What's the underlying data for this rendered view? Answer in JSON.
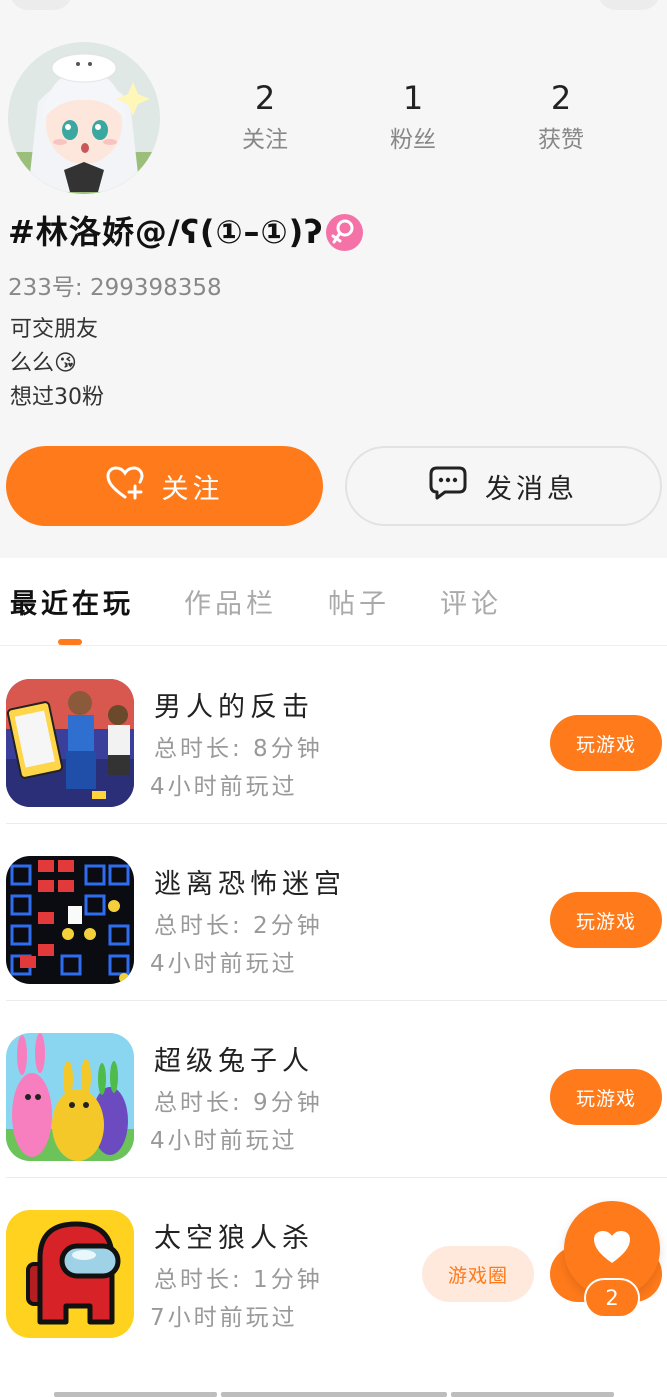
{
  "profile": {
    "nickname": "#林洛娇@/ʕ(①–①)ʔ",
    "uid_text": "233号: 299398358",
    "bio_lines": [
      "可交朋友",
      "么么😘",
      "想过30粉"
    ],
    "stats": [
      {
        "value": "2",
        "label": "关注"
      },
      {
        "value": "1",
        "label": "粉丝"
      },
      {
        "value": "2",
        "label": "获赞"
      }
    ],
    "gender_symbol": "♀",
    "follow_label": "关注",
    "message_label": "发消息",
    "accent_color": "#ff7a1a",
    "gender_color": "#f472a8"
  },
  "tabs": [
    "最近在玩",
    "作品栏",
    "帖子",
    "评论"
  ],
  "games": [
    {
      "name": "男人的反击",
      "duration": "总时长: 8分钟",
      "last_played": "4小时前玩过",
      "action": "玩游戏",
      "icon": "man-fightback-game-icon"
    },
    {
      "name": "逃离恐怖迷宫",
      "duration": "总时长: 2分钟",
      "last_played": "4小时前玩过",
      "action": "玩游戏",
      "icon": "horror-maze-game-icon"
    },
    {
      "name": "超级兔子人",
      "duration": "总时长: 9分钟",
      "last_played": "4小时前玩过",
      "action": "玩游戏",
      "icon": "super-bunny-man-game-icon"
    },
    {
      "name": "太空狼人杀",
      "duration": "总时长: 1分钟",
      "last_played": "7小时前玩过",
      "action": "游戏圈",
      "icon": "among-us-game-icon"
    }
  ],
  "fab": {
    "count": "2",
    "icon": "heart-icon"
  }
}
